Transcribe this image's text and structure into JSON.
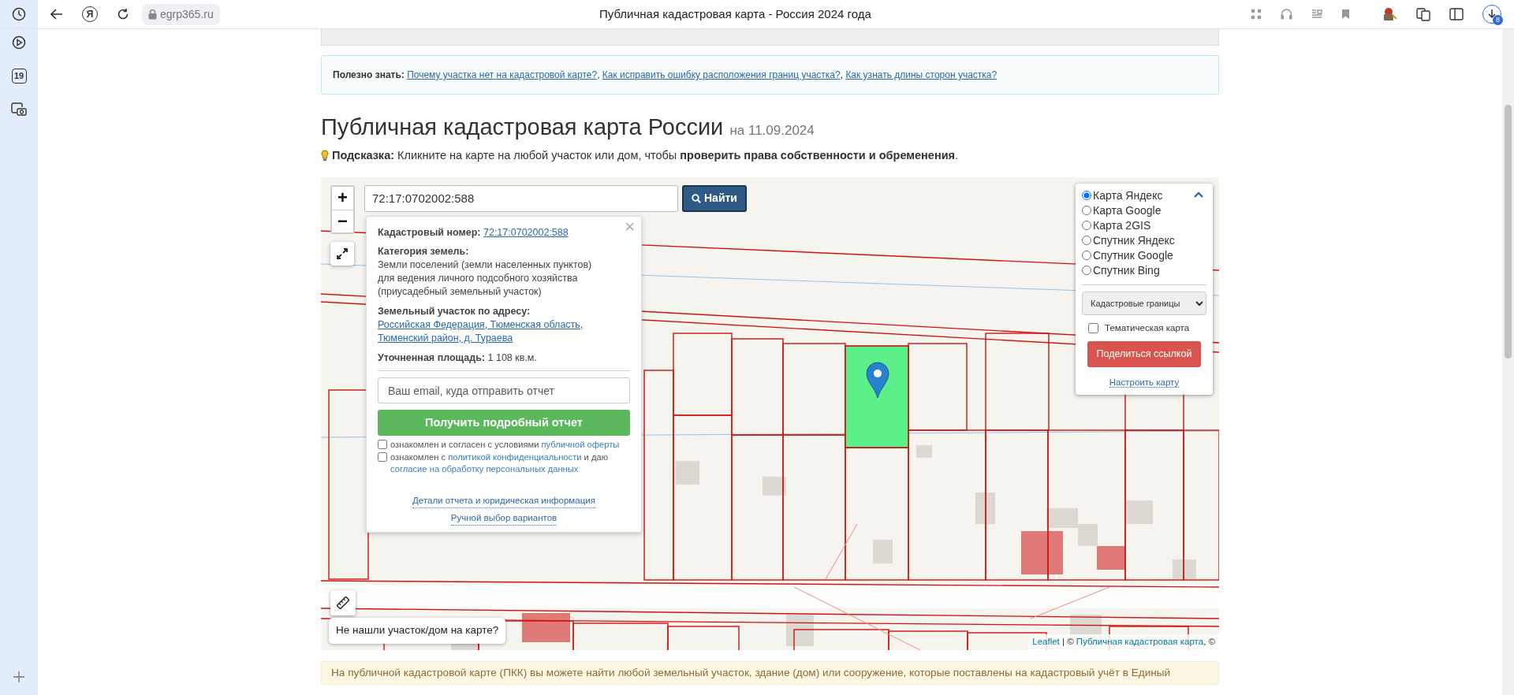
{
  "browser": {
    "home_glyph": "Я",
    "address": "egrp365.ru",
    "title": "Публичная кадастровая карта - Россия 2024 года",
    "downloads_badge": "8"
  },
  "sidebar": {
    "calendar_day": "19"
  },
  "info": {
    "label": "Полезно знать:",
    "separator": ", ",
    "links": [
      "Почему участка нет на кадастровой карте?",
      "Как исправить ошибку расположения границ участка?",
      "Как узнать длины сторон участка?"
    ]
  },
  "heading": {
    "title": "Публичная кадастровая карта России",
    "date": "на 11.09.2024"
  },
  "hint": "**Подсказка:** Кликните на карте на любой участок или дом, чтобы **проверить права собственности и обременения**.",
  "map": {
    "zoom_in": "+",
    "zoom_out": "−",
    "search": {
      "value": "72:17:0702002:588"
    },
    "search_button": "Найти",
    "popup": {
      "close": "×",
      "fields": [
        {
          "label": "Кадастровый номер:",
          "kind": "link",
          "value": "72:17:0702002:588"
        },
        {
          "label": "Категория земель:",
          "kind": "text",
          "value": "Земли поселений (земли населенных пунктов)",
          "note": "для ведения личного подсобного хозяйства (приусадебный земельный участок)"
        },
        {
          "label": "Земельный участок по адресу:",
          "kind": "link",
          "value": "Российская Федерация, Тюменская область, Тюменский район, д. Тураева"
        },
        {
          "label": "Уточненная площадь:",
          "kind": "text",
          "value": "1 108 кв.м."
        }
      ],
      "email": {
        "placeholder": "Ваш email, куда отправить отчет"
      },
      "report_button": "Получить подробный отчет",
      "agreements": [
        {
          "checked": false,
          "parts": [
            {
              "kind": "text",
              "text": "ознакомлен и согласен с условиями "
            },
            {
              "kind": "link",
              "text": "публичной оферты"
            }
          ]
        },
        {
          "checked": false,
          "parts": [
            {
              "kind": "text",
              "text": "ознакомлен с "
            },
            {
              "kind": "link",
              "text": "политикой конфиденциальности"
            },
            {
              "kind": "text",
              "text": " и даю "
            },
            {
              "kind": "link",
              "text": "согласие на обработку персональных данных"
            }
          ]
        }
      ],
      "footer_links": [
        "Детали отчета и юридическая информация",
        "Ручной выбор вариантов"
      ]
    },
    "layers": {
      "expanded": true,
      "options": [
        {
          "label": "Карта Яндекс",
          "selected": true
        },
        {
          "label": "Карта Google",
          "selected": false
        },
        {
          "label": "Карта 2GIS",
          "selected": false
        },
        {
          "label": "Спутник Яндекс",
          "selected": false
        },
        {
          "label": "Спутник Google",
          "selected": false
        },
        {
          "label": "Спутник Bing",
          "selected": false
        }
      ],
      "overlay_select": "Кадастровые границы",
      "thematic": {
        "label": "Тематическая карта",
        "checked": false
      },
      "share_button": "Поделиться ссылкой",
      "configure_link": "Настроить карту"
    },
    "not_found_tooltip": "Не нашли участок/дом на карте?",
    "attribution": [
      {
        "kind": "link",
        "text": "Leaflet"
      },
      {
        "kind": "text",
        "text": " | © "
      },
      {
        "kind": "link",
        "text": "Публичная кадастровая карта"
      },
      {
        "kind": "text",
        "text": ", ©"
      }
    ]
  },
  "notice": "На публичной кадастровой карте (ПКК) вы можете найти любой земельный участок, здание (дом) или сооружение, которые поставлены на кадастровый учёт в Единый"
}
